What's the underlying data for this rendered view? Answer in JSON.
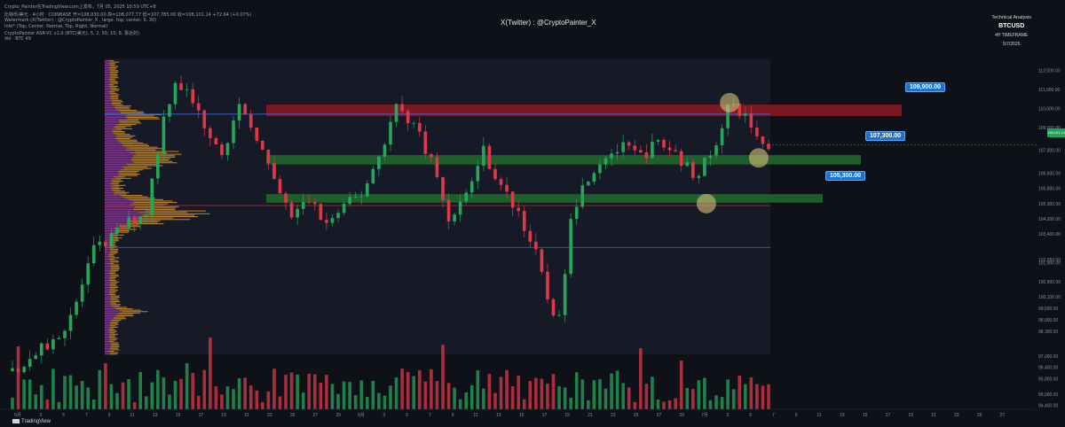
{
  "header": {
    "line1": "Crypto_Painter在TradingView.com上发布，7月 05, 2025 10:59 UTC+8",
    "line2": "比特币/美元 · 4小时 · COINBASE  开=108,030.00  高=108,077.77  低=107,785.00  收=108,101.14  +72.64 (+0.07%)",
    "line3": "Watermark (X(Twitter) : @CryptoPainter_X , large, top, center, 5, 30)",
    "line4": "Info* (Top, Center, Normal, Top, Right, Normal)",
    "line5": "CryptoPainter ASR-VC v1.0 (BTC(美元), 5, 2, 50, 10, 8, 靠近的)",
    "line6": "Vol · BTC  49"
  },
  "watermark": "X(Twitter) : @CryptoPainter_X",
  "info_box": {
    "title": "Technical Analysis",
    "symbol": "BTCUSD",
    "timeframe": "4H TIMEFRAME",
    "date": "5/7/2025"
  },
  "levels": [
    {
      "label": "109,900.00",
      "price": 109900
    },
    {
      "label": "107,300.00",
      "price": 107300
    },
    {
      "label": "105,300.00",
      "price": 105300
    }
  ],
  "current_price": {
    "label": "108,101.14",
    "color": "#1fa35a"
  },
  "footer": {
    "logo_text": "TradingView"
  },
  "colors": {
    "background": "#0f1118",
    "resistance_zone": "#8b1a22",
    "support_zone": "#1f6b2c",
    "blue_line": "#3d6bd6",
    "red_line": "#c2283a",
    "label_bg": "#1e73c8",
    "profile_purple": "#9b3aa8",
    "profile_orange": "#d4902a",
    "candle_up": "#26a65b",
    "candle_down": "#e0384b"
  },
  "chart_data": {
    "type": "candlestick",
    "symbol": "BTCUSD",
    "timeframe": "4H",
    "ylim": [
      94200,
      112900
    ],
    "y_ticks": [
      "112,000.00",
      "111,000.00",
      "110,000.00",
      "109,000.00",
      "107,800.00",
      "106,600.00",
      "105,800.00",
      "105,000.00",
      "104,200.00",
      "103,400.00",
      "102,050.00",
      "101,900.00",
      "100,900.00",
      "100,100.00",
      "99,500.00",
      "98,900.00",
      "98,300.00",
      "97,000.00",
      "96,400.00",
      "95,800.00",
      "95,000.00",
      "94,400.00"
    ],
    "x_tick_labels": [
      "5月",
      "3",
      "5",
      "7",
      "9",
      "11",
      "13",
      "15",
      "17",
      "19",
      "21",
      "23",
      "25",
      "27",
      "29",
      "6月",
      "3",
      "5",
      "7",
      "9",
      "11",
      "13",
      "15",
      "17",
      "19",
      "21",
      "23",
      "25",
      "27",
      "29",
      "7月",
      "3",
      "5",
      "7",
      "9",
      "11",
      "13",
      "15",
      "17",
      "19",
      "21",
      "23",
      "25",
      "27"
    ],
    "close_path": [
      [
        0,
        96200
      ],
      [
        8,
        98000
      ],
      [
        11,
        99800
      ],
      [
        14,
        102500
      ],
      [
        17,
        103200
      ],
      [
        20,
        104000
      ],
      [
        23,
        104600
      ],
      [
        26,
        109500
      ],
      [
        28,
        111500
      ],
      [
        30,
        110800
      ],
      [
        33,
        109200
      ],
      [
        36,
        107800
      ],
      [
        39,
        109900
      ],
      [
        42,
        108600
      ],
      [
        45,
        106000
      ],
      [
        48,
        104300
      ],
      [
        51,
        105200
      ],
      [
        54,
        103900
      ],
      [
        57,
        104800
      ],
      [
        60,
        105500
      ],
      [
        63,
        107500
      ],
      [
        66,
        110100
      ],
      [
        69,
        109200
      ],
      [
        72,
        107300
      ],
      [
        75,
        104200
      ],
      [
        78,
        105500
      ],
      [
        81,
        107800
      ],
      [
        84,
        105800
      ],
      [
        87,
        104600
      ],
      [
        90,
        102300
      ],
      [
        92,
        100000
      ],
      [
        94,
        98800
      ],
      [
        96,
        104500
      ],
      [
        99,
        106500
      ],
      [
        102,
        107600
      ],
      [
        105,
        107900
      ],
      [
        108,
        107500
      ],
      [
        111,
        108200
      ],
      [
        114,
        107700
      ],
      [
        117,
        106500
      ],
      [
        120,
        107400
      ],
      [
        123,
        110100
      ],
      [
        126,
        109600
      ],
      [
        129,
        108100
      ]
    ],
    "zones": [
      {
        "type": "resistance",
        "low": 109600,
        "high": 110200
      },
      {
        "type": "support",
        "low": 107050,
        "high": 107550
      },
      {
        "type": "support",
        "low": 105050,
        "high": 105500
      }
    ],
    "lines": [
      {
        "price": 109700,
        "color": "#3d6bd6"
      },
      {
        "price": 104900,
        "color": "#c2283a"
      },
      {
        "price": 102700,
        "color": "#3d6bd6"
      }
    ],
    "highlight_circles": [
      {
        "x_index": 123,
        "price": 110300
      },
      {
        "x_index": 128,
        "price": 107400
      },
      {
        "x_index": 119,
        "price": 105000
      }
    ]
  }
}
